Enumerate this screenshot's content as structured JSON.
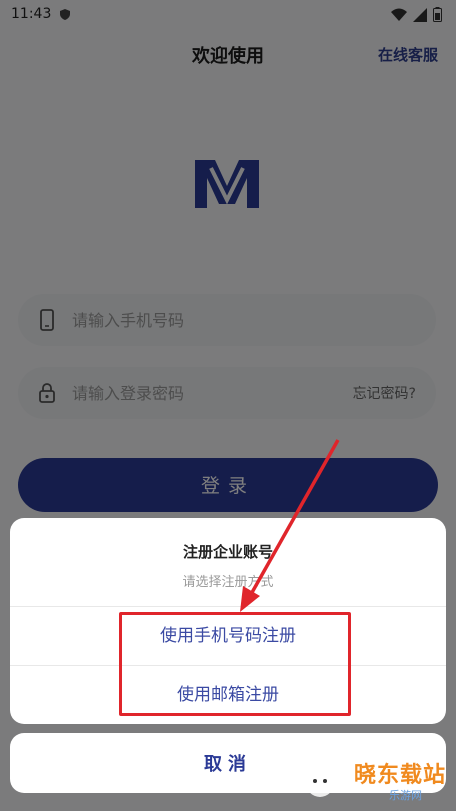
{
  "status_bar": {
    "time": "11:43"
  },
  "header": {
    "title": "欢迎使用",
    "support_link": "在线客服"
  },
  "form": {
    "phone_placeholder": "请输入手机号码",
    "password_placeholder": "请输入登录密码",
    "forgot_password": "忘记密码?",
    "login_label": "登录"
  },
  "sheet": {
    "title": "注册企业账号",
    "subtitle": "请选择注册方式",
    "options": [
      "使用手机号码注册",
      "使用邮箱注册"
    ],
    "cancel_label": "取消"
  },
  "watermark": {
    "text": "晓东载站",
    "sub": "乐游网"
  },
  "colors": {
    "accent": "#2b3a96",
    "annotation": "#e0252b"
  }
}
